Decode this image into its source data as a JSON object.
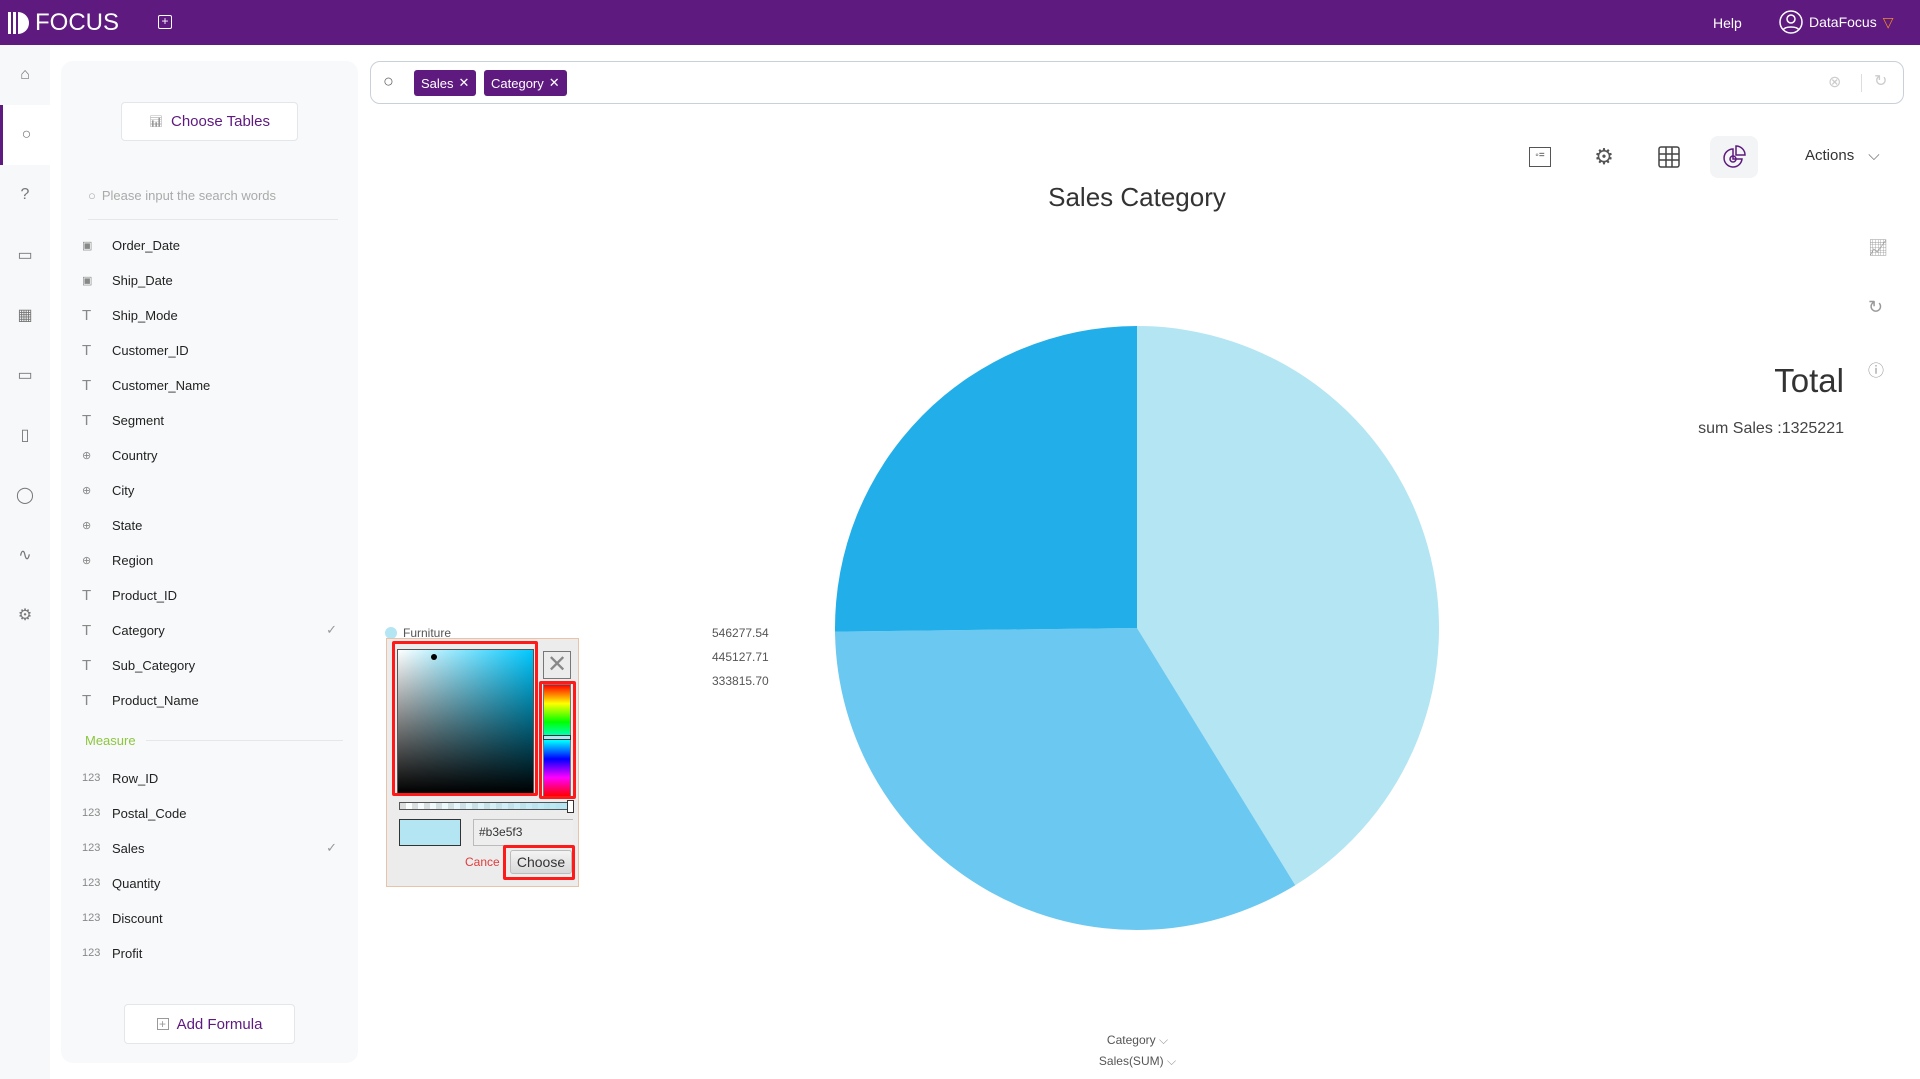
{
  "app": {
    "logo": "FOCUS",
    "help": "Help",
    "user": "DataFocus"
  },
  "rail": [
    "home-icon",
    "search-icon",
    "help-icon",
    "presentation-icon",
    "table-icon",
    "folder-icon",
    "clipboard-icon",
    "user-icon",
    "activity-icon",
    "gear-icon"
  ],
  "sidebar": {
    "choose_tables": "Choose Tables",
    "search_placeholder": "Please input the search words",
    "attributes": [
      {
        "name": "Order_Date",
        "type": "date",
        "checked": false
      },
      {
        "name": "Ship_Date",
        "type": "date",
        "checked": false
      },
      {
        "name": "Ship_Mode",
        "type": "text",
        "checked": false
      },
      {
        "name": "Customer_ID",
        "type": "text",
        "checked": false
      },
      {
        "name": "Customer_Name",
        "type": "text",
        "checked": false
      },
      {
        "name": "Segment",
        "type": "text",
        "checked": false
      },
      {
        "name": "Country",
        "type": "geo",
        "checked": false
      },
      {
        "name": "City",
        "type": "geo",
        "checked": false
      },
      {
        "name": "State",
        "type": "geo",
        "checked": false
      },
      {
        "name": "Region",
        "type": "geo",
        "checked": false
      },
      {
        "name": "Product_ID",
        "type": "text",
        "checked": false
      },
      {
        "name": "Category",
        "type": "text",
        "checked": true
      },
      {
        "name": "Sub_Category",
        "type": "text",
        "checked": false
      },
      {
        "name": "Product_Name",
        "type": "text",
        "checked": false
      }
    ],
    "measure_label": "Measure",
    "measures": [
      {
        "name": "Row_ID",
        "checked": false
      },
      {
        "name": "Postal_Code",
        "checked": false
      },
      {
        "name": "Sales",
        "checked": true
      },
      {
        "name": "Quantity",
        "checked": false
      },
      {
        "name": "Discount",
        "checked": false
      },
      {
        "name": "Profit",
        "checked": false
      }
    ],
    "add_formula": "Add Formula"
  },
  "search": {
    "chips": [
      "Sales",
      "Category"
    ]
  },
  "toolbar": {
    "actions": "Actions"
  },
  "total": {
    "title": "Total",
    "value": "sum Sales :1325221"
  },
  "axis": {
    "category": "Category",
    "measure": "Sales(SUM)"
  },
  "picker": {
    "hex": "#b3e5f3",
    "cancel": "Cance",
    "choose": "Choose",
    "hue_marker_color": "#b3e5f3"
  },
  "chart_data": {
    "type": "pie",
    "title": "Sales Category",
    "legend_entries": [
      "Furniture"
    ],
    "labels": [
      "546277.54",
      "445127.71",
      "333815.70"
    ],
    "values": [
      546277.54,
      445127.71,
      333815.7
    ],
    "colors": [
      "#b3e5f3",
      "#6bc8f0",
      "#22aee8"
    ],
    "total": 1325221
  }
}
